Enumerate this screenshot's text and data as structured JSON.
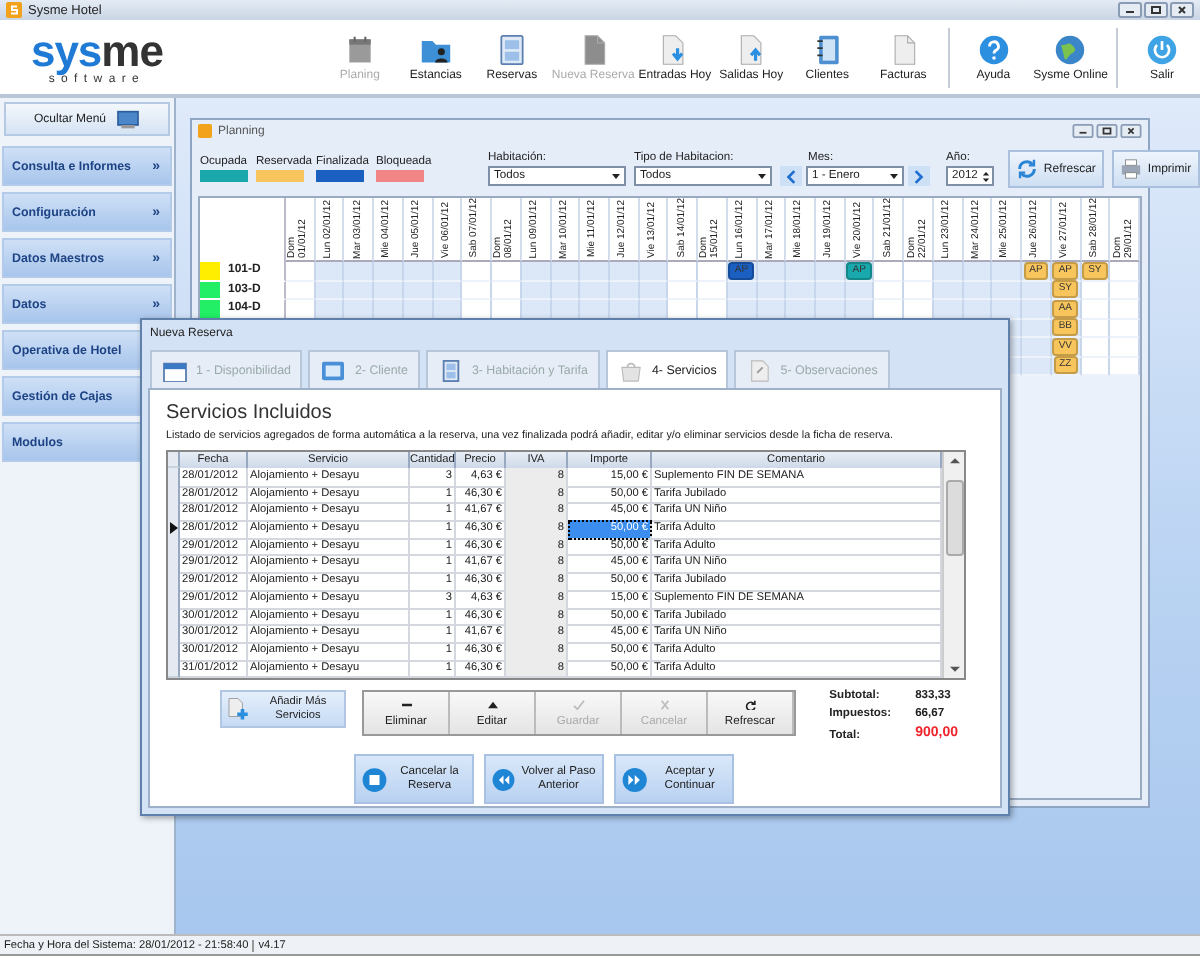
{
  "window": {
    "title": "Sysme Hotel"
  },
  "logo": {
    "words": [
      "sys",
      "me"
    ],
    "tagline": "software"
  },
  "toolbar": [
    {
      "label": "Planing",
      "disabled": true,
      "separator_before": false
    },
    {
      "label": "Estancias",
      "disabled": false,
      "separator_before": false
    },
    {
      "label": "Reservas",
      "disabled": false,
      "separator_before": false
    },
    {
      "label": "Nueva Reserva",
      "disabled": true,
      "separator_before": false
    },
    {
      "label": "Entradas Hoy",
      "disabled": false,
      "separator_before": false
    },
    {
      "label": "Salidas Hoy",
      "disabled": false,
      "separator_before": false
    },
    {
      "label": "Clientes",
      "disabled": false,
      "separator_before": false
    },
    {
      "label": "Facturas",
      "disabled": false,
      "separator_before": false
    },
    {
      "label": "Ayuda",
      "disabled": false,
      "separator_before": true
    },
    {
      "label": "Sysme Online",
      "disabled": false,
      "separator_before": false
    },
    {
      "label": "Salir",
      "disabled": false,
      "separator_before": true
    }
  ],
  "sidebar": {
    "toggle": "Ocultar Menú",
    "items": [
      {
        "label": "Consulta e Informes",
        "expander": "»"
      },
      {
        "label": "Configuración",
        "expander": "»"
      },
      {
        "label": "Datos Maestros",
        "expander": "»"
      },
      {
        "label": "Datos",
        "expander": "»"
      },
      {
        "label": "Operativa de Hotel"
      },
      {
        "label": "Gestión de Cajas"
      },
      {
        "label": "Modulos"
      }
    ]
  },
  "planning": {
    "title": "Planning",
    "legend": [
      {
        "label": "Ocupada",
        "color": "#19a9ad"
      },
      {
        "label": "Reservada",
        "color": "#f7c55c"
      },
      {
        "label": "Finalizada",
        "color": "#1b5fc0"
      },
      {
        "label": "Bloqueada",
        "color": "#f28585"
      }
    ],
    "filters": {
      "habitacion": {
        "label": "Habitación:",
        "value": "Todos"
      },
      "tipo": {
        "label": "Tipo de Habitacion:",
        "value": "Todos"
      },
      "mes": {
        "label": "Mes:",
        "value": "1 - Enero"
      },
      "anio": {
        "label": "Año:",
        "value": "2012"
      }
    },
    "buttons": [
      "Refrescar",
      "Imprimir"
    ],
    "days": [
      "Dom 01/01/12",
      "Lun 02/01/12",
      "Mar 03/01/12",
      "Mie 04/01/12",
      "Jue 05/01/12",
      "Vie 06/01/12",
      "Sab 07/01/12",
      "Dom 08/01/12",
      "Lun 09/01/12",
      "Mar 10/01/12",
      "Mie 11/01/12",
      "Jue 12/01/12",
      "Vie 13/01/12",
      "Sab 14/01/12",
      "Dom 15/01/12",
      "Lun 16/01/12",
      "Mar 17/01/12",
      "Mie 18/01/12",
      "Jue 19/01/12",
      "Vie 20/01/12",
      "Sab 21/01/12",
      "Dom 22/01/12",
      "Lun 23/01/12",
      "Mar 24/01/12",
      "Mie 25/01/12",
      "Jue 26/01/12",
      "Vie 27/01/12",
      "Sab 28/01/12",
      "Dom 29/01/12"
    ],
    "rows": [
      {
        "room": "101-D",
        "color": "#ffee00",
        "cells": [
          null,
          null,
          null,
          null,
          null,
          null,
          null,
          null,
          null,
          null,
          null,
          null,
          null,
          null,
          null,
          {
            "code": "AP",
            "color": "#1b5fc0"
          },
          null,
          null,
          null,
          {
            "code": "AP",
            "color": "#19a9ad"
          },
          null,
          null,
          null,
          null,
          null,
          {
            "code": "AP",
            "color": "#f7c55c"
          },
          {
            "code": "AP",
            "color": "#f7c55c"
          },
          {
            "code": "SY",
            "color": "#f7c55c"
          },
          null
        ]
      },
      {
        "room": "103-D",
        "color": "#22ee66",
        "cells": [
          null,
          null,
          null,
          null,
          null,
          null,
          null,
          null,
          null,
          null,
          null,
          null,
          null,
          null,
          null,
          null,
          null,
          null,
          null,
          null,
          null,
          null,
          null,
          null,
          null,
          null,
          {
            "code": "SY",
            "color": "#f7c55c"
          },
          null,
          null
        ]
      },
      {
        "room": "104-D",
        "color": "#22ee66",
        "cells": [
          null,
          null,
          null,
          null,
          null,
          null,
          null,
          null,
          null,
          null,
          null,
          null,
          null,
          null,
          null,
          null,
          null,
          null,
          null,
          null,
          null,
          null,
          null,
          null,
          null,
          null,
          {
            "code": "AA",
            "color": "#f7c55c"
          },
          null,
          null
        ]
      },
      {
        "cells": [
          null,
          null,
          null,
          null,
          null,
          null,
          null,
          null,
          null,
          null,
          null,
          null,
          null,
          null,
          null,
          null,
          null,
          null,
          null,
          null,
          null,
          null,
          null,
          null,
          null,
          null,
          {
            "code": "BB",
            "color": "#f7c55c"
          },
          null,
          null
        ]
      },
      {
        "cells": [
          null,
          null,
          null,
          null,
          null,
          null,
          null,
          null,
          null,
          null,
          null,
          null,
          null,
          null,
          null,
          null,
          null,
          null,
          null,
          null,
          null,
          null,
          null,
          null,
          null,
          null,
          {
            "code": "VV",
            "color": "#f7c55c"
          },
          null,
          null
        ]
      },
      {
        "cells": [
          null,
          null,
          null,
          null,
          null,
          null,
          null,
          null,
          null,
          null,
          null,
          null,
          null,
          null,
          null,
          null,
          null,
          null,
          null,
          null,
          null,
          null,
          null,
          null,
          null,
          null,
          {
            "code": "ZZ",
            "color": "#f7c55c"
          },
          null,
          null
        ]
      }
    ]
  },
  "dialog": {
    "title": "Nueva Reserva",
    "tabs": [
      {
        "label": "1 - Disponibilidad",
        "selected": false
      },
      {
        "label": "2- Cliente",
        "selected": false
      },
      {
        "label": "3- Habitación y Tarifa",
        "selected": false
      },
      {
        "label": "4- Servicios",
        "selected": true
      },
      {
        "label": "5- Observaciones",
        "selected": false
      }
    ],
    "heading": "Servicios Incluidos",
    "description": "Listado de servicios agregados de forma automática a la reserva, una vez finalizada podrá añadir, editar y/o eliminar servicios desde la ficha de reserva.",
    "table": {
      "columns": [
        "Fecha",
        "Servicio",
        "Cantidad",
        "Precio",
        "IVA",
        "Importe",
        "Comentario"
      ],
      "rows": [
        {
          "selected": false,
          "cells": [
            "28/01/2012",
            "Alojamiento + Desayu",
            "3",
            "4,63 €",
            "8",
            "15,00 €",
            "Suplemento FIN DE SEMANA"
          ]
        },
        {
          "selected": false,
          "cells": [
            "28/01/2012",
            "Alojamiento + Desayu",
            "1",
            "46,30 €",
            "8",
            "50,00 €",
            "Tarifa Jubilado"
          ]
        },
        {
          "selected": false,
          "cells": [
            "28/01/2012",
            "Alojamiento + Desayu",
            "1",
            "41,67 €",
            "8",
            "45,00 €",
            "Tarifa UN Niño"
          ]
        },
        {
          "selected": true,
          "cells": [
            "28/01/2012",
            "Alojamiento + Desayu",
            "1",
            "46,30 €",
            "8",
            "50,00 €",
            "Tarifa Adulto"
          ]
        },
        {
          "selected": false,
          "cells": [
            "29/01/2012",
            "Alojamiento + Desayu",
            "1",
            "46,30 €",
            "8",
            "50,00 €",
            "Tarifa Adulto"
          ]
        },
        {
          "selected": false,
          "cells": [
            "29/01/2012",
            "Alojamiento + Desayu",
            "1",
            "41,67 €",
            "8",
            "45,00 €",
            "Tarifa UN Niño"
          ]
        },
        {
          "selected": false,
          "cells": [
            "29/01/2012",
            "Alojamiento + Desayu",
            "1",
            "46,30 €",
            "8",
            "50,00 €",
            "Tarifa Jubilado"
          ]
        },
        {
          "selected": false,
          "cells": [
            "29/01/2012",
            "Alojamiento + Desayu",
            "3",
            "4,63 €",
            "8",
            "15,00 €",
            "Suplemento FIN DE SEMANA"
          ]
        },
        {
          "selected": false,
          "cells": [
            "30/01/2012",
            "Alojamiento + Desayu",
            "1",
            "46,30 €",
            "8",
            "50,00 €",
            "Tarifa Jubilado"
          ]
        },
        {
          "selected": false,
          "cells": [
            "30/01/2012",
            "Alojamiento + Desayu",
            "1",
            "41,67 €",
            "8",
            "45,00 €",
            "Tarifa UN Niño"
          ]
        },
        {
          "selected": false,
          "cells": [
            "30/01/2012",
            "Alojamiento + Desayu",
            "1",
            "46,30 €",
            "8",
            "50,00 €",
            "Tarifa Adulto"
          ]
        },
        {
          "selected": false,
          "cells": [
            "31/01/2012",
            "Alojamiento + Desayu",
            "1",
            "46,30 €",
            "8",
            "50,00 €",
            "Tarifa Adulto"
          ]
        }
      ]
    },
    "add_button": "Añadir Más Servicios",
    "actions": [
      {
        "label": "Eliminar",
        "disabled": false
      },
      {
        "label": "Editar",
        "disabled": false
      },
      {
        "label": "Guardar",
        "disabled": true
      },
      {
        "label": "Cancelar",
        "disabled": true
      },
      {
        "label": "Refrescar",
        "disabled": false
      }
    ],
    "totals": [
      {
        "label": "Subtotal:",
        "value": "833,33",
        "kind": "normal"
      },
      {
        "label": "Impuestos:",
        "value": "66,67",
        "kind": "normal"
      },
      {
        "label": "Total:",
        "value": "900,00",
        "kind": "total"
      }
    ],
    "nav_buttons": [
      "Cancelar la Reserva",
      "Volver al Paso Anterior",
      "Aceptar y Continuar"
    ]
  },
  "status_bar": {
    "text": "Fecha y Hora del Sistema: 28/01/2012 - 21:58:40",
    "version": "v4.17"
  }
}
